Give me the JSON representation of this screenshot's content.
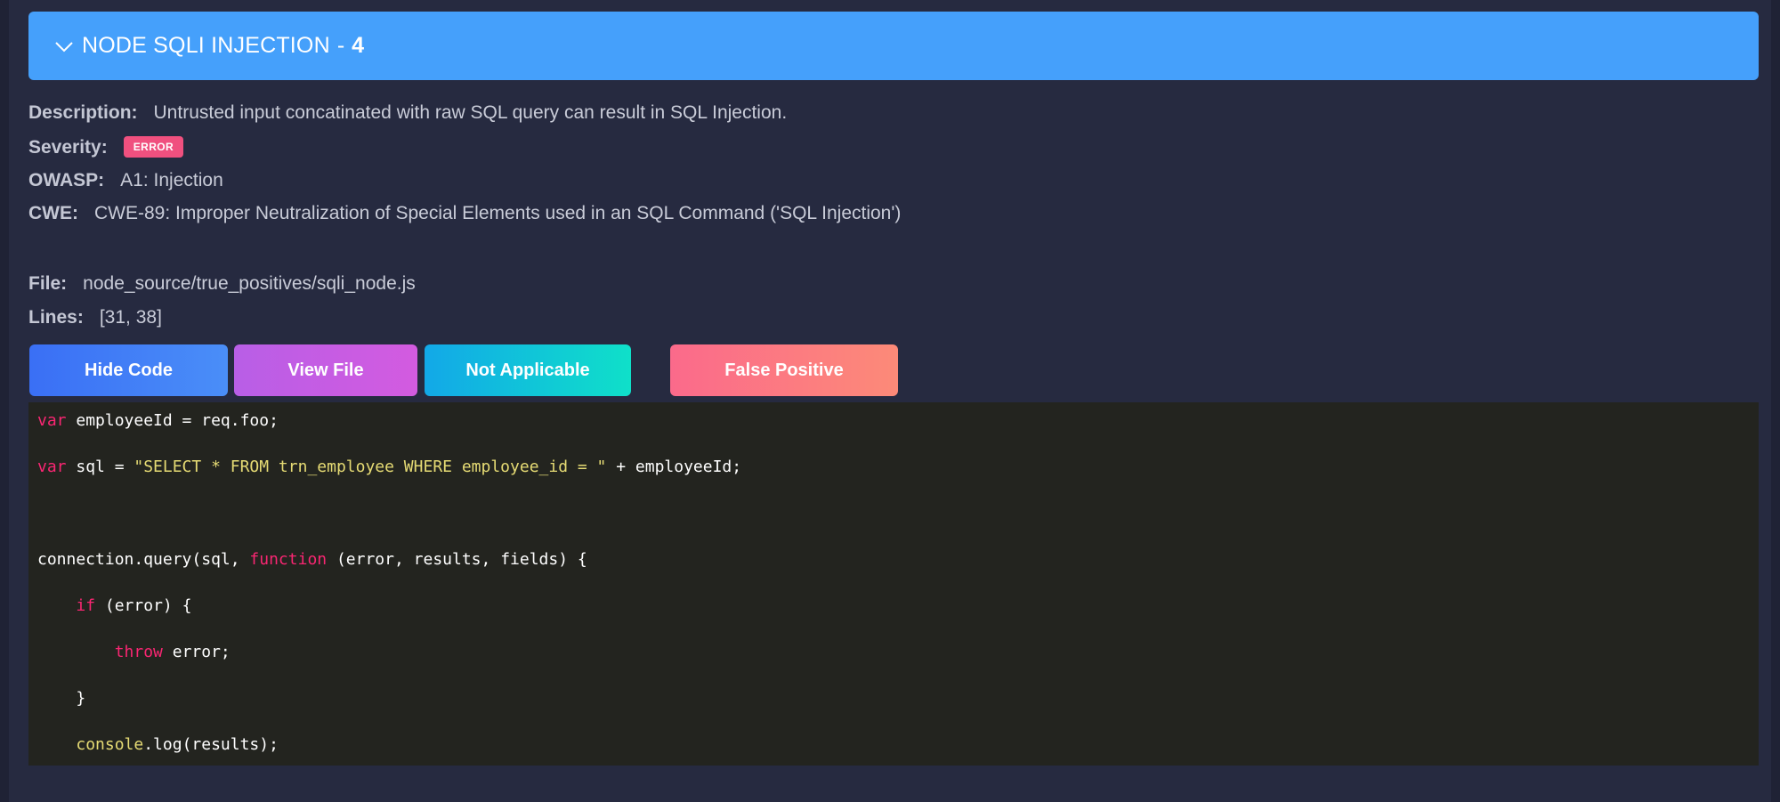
{
  "header": {
    "title": "NODE SQLI INJECTION",
    "separator": "-",
    "count": "4"
  },
  "details": {
    "description_label": "Description:",
    "description": "Untrusted input concatinated with raw SQL query can result in SQL Injection.",
    "severity_label": "Severity:",
    "severity": "ERROR",
    "owasp_label": "OWASP:",
    "owasp": "A1: Injection",
    "cwe_label": "CWE:",
    "cwe": "CWE-89: Improper Neutralization of Special Elements used in an SQL Command ('SQL Injection')",
    "file_label": "File:",
    "file": "node_source/true_positives/sqli_node.js",
    "lines_label": "Lines:",
    "lines": "[31, 38]"
  },
  "buttons": {
    "hide_code": "Hide Code",
    "view_file": "View File",
    "not_applicable": "Not Applicable",
    "false_positive": "False Positive"
  },
  "code": {
    "l1_kw": "var",
    "l1_rest": " employeeId = req.foo;",
    "l2_kw": "var",
    "l2_mid": " sql = ",
    "l2_str": "\"SELECT * FROM trn_employee WHERE employee_id = \"",
    "l2_rest": " + employeeId;",
    "l3_pre": "connection.query(sql, ",
    "l3_kw": "function",
    "l3_rest": " (error, results, fields) {",
    "l4_indent": "    ",
    "l4_kw": "if",
    "l4_rest": " (error) {",
    "l5_indent": "        ",
    "l5_kw": "throw",
    "l5_rest": " error;",
    "l6": "    }",
    "l7_indent": "    ",
    "l7_fn": "console",
    "l7_rest": ".log(results);"
  },
  "colors": {
    "header_bg": "#45a0fb",
    "error_badge": "#f0507f",
    "code_bg": "#23241f",
    "keyword": "#f92672",
    "string": "#e6db74"
  }
}
